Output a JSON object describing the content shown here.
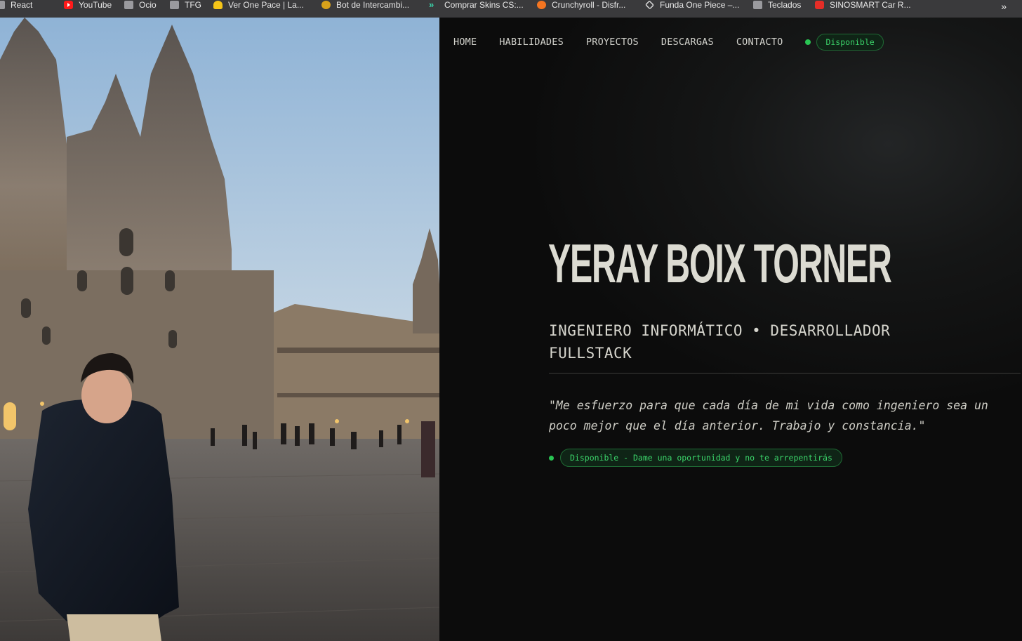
{
  "bookmarks": [
    {
      "label": "React",
      "icon": "folder-icon"
    },
    {
      "label": "YouTube",
      "icon": "youtube-icon"
    },
    {
      "label": "Ocio",
      "icon": "folder-icon"
    },
    {
      "label": "TFG",
      "icon": "folder-icon"
    },
    {
      "label": "Ver One Pace | La...",
      "icon": "straw-hat-icon"
    },
    {
      "label": "Bot de Intercambi...",
      "icon": "coin-icon"
    },
    {
      "label": "Comprar Skins CS:...",
      "icon": "arrow-logo-icon"
    },
    {
      "label": "Crunchyroll - Disfr...",
      "icon": "crunchyroll-icon"
    },
    {
      "label": "Funda One Piece –...",
      "icon": "hexagon-icon"
    },
    {
      "label": "Teclados",
      "icon": "folder-icon"
    },
    {
      "label": "SINOSMART Car R...",
      "icon": "aliexpress-icon"
    }
  ],
  "bookmarks_overflow": "»",
  "nav": {
    "links": [
      "HOME",
      "HABILIDADES",
      "PROYECTOS",
      "DESCARGAS",
      "CONTACTO"
    ],
    "status": "Disponible"
  },
  "hero": {
    "name": "YERAY BOIX TORNER",
    "role": "INGENIERO INFORMÁTICO • DESARROLLADOR FULLSTACK",
    "quote": "\"Me esfuerzo para que cada día de mi vida como ingeniero sea un poco mejor que el día anterior. Trabajo y constancia.\"",
    "status": "Disponible - Dame una oportunidad y no te arrepentirás"
  },
  "colors": {
    "accent_green": "#29c553",
    "background": "#0d0d0d",
    "text": "#dcdbd2"
  }
}
